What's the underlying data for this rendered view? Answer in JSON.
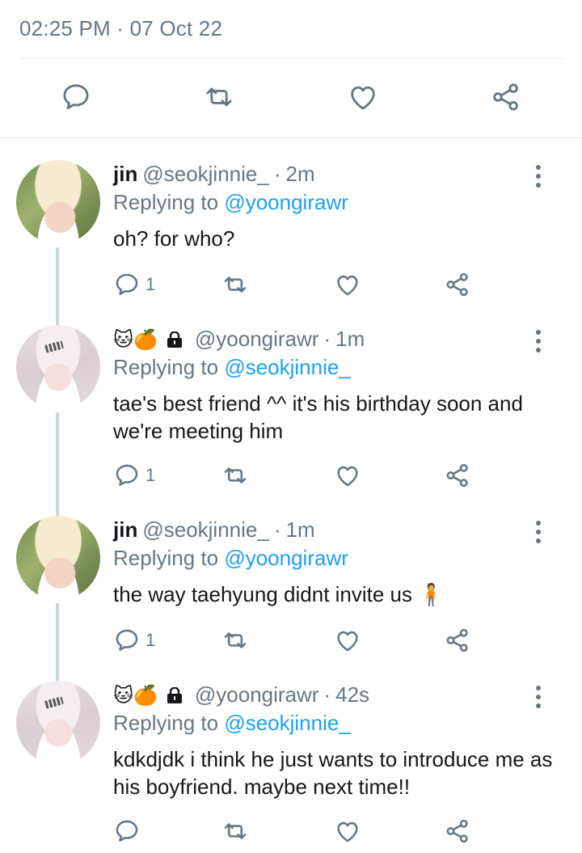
{
  "tweet": {
    "timestamp": "02:25 PM · 07 Oct 22"
  },
  "colors": {
    "text": "#14171a",
    "muted": "#657786",
    "link": "#1da1f2",
    "divider": "#e1e8ed",
    "thread": "#ccd6dd"
  },
  "icons": [
    "reply-icon",
    "retweet-icon",
    "like-icon",
    "share-icon",
    "more-icon",
    "lock-icon"
  ],
  "replies": [
    {
      "name": "jin",
      "handle": "@seokjinnie_",
      "time": "2m",
      "replying_label": "Replying to",
      "replying_to": "@yoongirawr",
      "text": "oh? for who?",
      "reply_count": "1"
    },
    {
      "name_emojis": "🐱🍊",
      "handle": "@yoongirawr",
      "time": "1m",
      "replying_label": "Replying to",
      "replying_to": "@seokjinnie_",
      "text": "tae's best friend ^^ it's his birthday soon and we're meeting him",
      "reply_count": "1"
    },
    {
      "name": "jin",
      "handle": "@seokjinnie_",
      "time": "1m",
      "replying_label": "Replying to",
      "replying_to": "@yoongirawr",
      "text": "the way taehyung didnt invite us 🧍",
      "reply_count": "1"
    },
    {
      "name_emojis": "🐱🍊",
      "handle": "@yoongirawr",
      "time": "42s",
      "replying_label": "Replying to",
      "replying_to": "@seokjinnie_",
      "text": "kdkdjdk i think he just wants to introduce me as his boyfriend. maybe next time!!",
      "reply_count": ""
    }
  ],
  "separator": "·"
}
